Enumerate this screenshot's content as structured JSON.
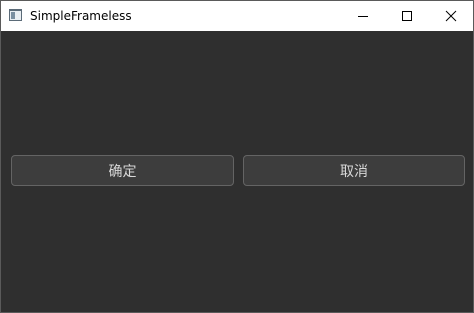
{
  "window": {
    "title": "SimpleFrameless",
    "icon": "app-window-icon",
    "controls": {
      "minimize_icon": "minimize-icon",
      "maximize_icon": "maximize-icon",
      "close_icon": "close-icon"
    }
  },
  "dialog": {
    "ok_label": "确定",
    "cancel_label": "取消"
  },
  "colors": {
    "titlebar": "#ffffff",
    "background": "#2f2f2f",
    "button_bg": "#3d3d3d",
    "button_border": "#646464",
    "button_text": "#d8d8d8"
  }
}
